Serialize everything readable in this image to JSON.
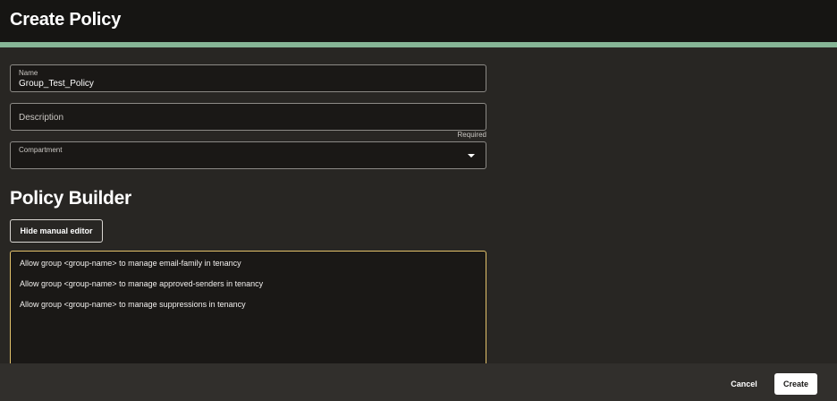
{
  "header": {
    "title": "Create Policy"
  },
  "form": {
    "name": {
      "label": "Name",
      "value": "Group_Test_Policy"
    },
    "description": {
      "placeholder": "Description",
      "required_note": "Required"
    },
    "compartment": {
      "label": "Compartment",
      "value": ""
    }
  },
  "policy_builder": {
    "title": "Policy Builder",
    "toggle_label": "Hide manual editor",
    "statements": [
      "Allow group <group-name> to manage email-family in tenancy",
      "Allow group <group-name> to manage approved-senders in tenancy",
      "Allow group <group-name> to manage suppressions in tenancy"
    ]
  },
  "footer": {
    "cancel_label": "Cancel",
    "create_label": "Create"
  },
  "colors": {
    "accent_bar": "#86b596",
    "editor_focus_border": "#e3c26b",
    "header_bg": "#161513",
    "page_bg": "#282623"
  },
  "icons": {
    "compartment_dropdown": "caret-down-icon"
  }
}
